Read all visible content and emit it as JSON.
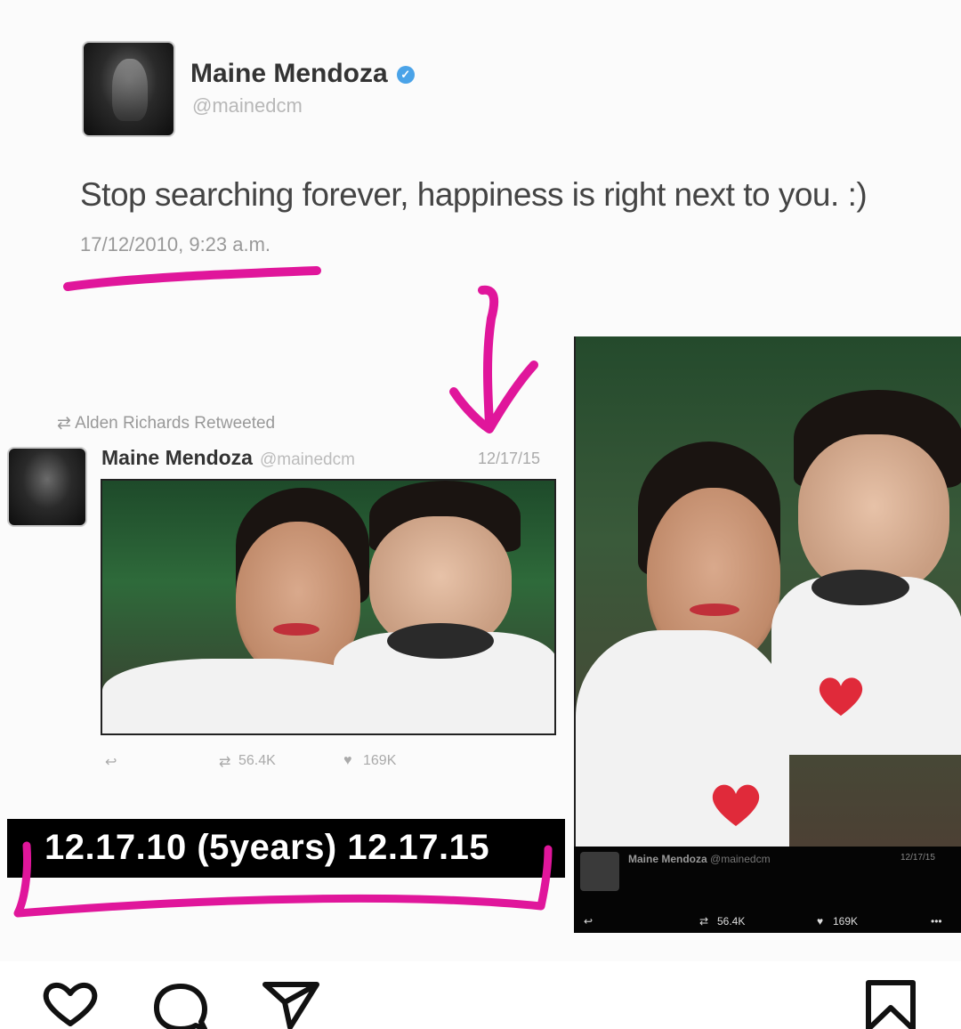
{
  "tweet_top": {
    "name": "Maine Mendoza",
    "handle": "@mainedcm",
    "text": "Stop searching forever, happiness is right next to you. :)",
    "timestamp": "17/12/2010, 9:23 a.m."
  },
  "tweet_retweet": {
    "retweet_label": "Alden Richards Retweeted",
    "name": "Maine Mendoza",
    "handle": "@mainedcm",
    "date": "12/17/15",
    "retweets": "56.4K",
    "likes": "169K"
  },
  "caption": "12.17.10 (5years) 12.17.15",
  "right_tweet": {
    "name": "Maine Mendoza",
    "handle": "@mainedcm",
    "date": "12/17/15",
    "retweets": "56.4K",
    "likes": "169K",
    "more": "•••"
  },
  "colors": {
    "annotation_pink": "#e0169b",
    "caption_bg": "#000000"
  },
  "icons": [
    "heart-icon",
    "comment-icon",
    "share-icon",
    "bookmark-icon",
    "reply-icon",
    "retweet-icon",
    "like-icon",
    "verified-icon"
  ]
}
